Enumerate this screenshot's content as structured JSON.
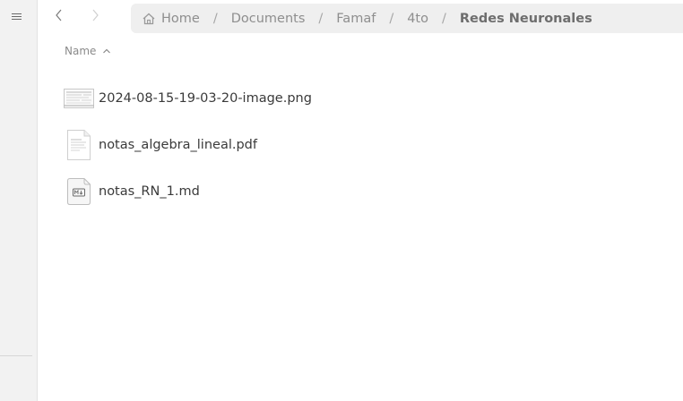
{
  "sidebar": {
    "menu_icon": "hamburger-menu-icon"
  },
  "navigation": {
    "back_icon": "chevron-left-icon",
    "forward_icon": "chevron-right-icon"
  },
  "pathbar": {
    "home_icon": "home-icon",
    "crumbs": [
      "Home",
      "Documents",
      "Famaf",
      "4to",
      "Redes Neuronales"
    ],
    "separator": "/"
  },
  "list": {
    "column_name": "Name",
    "sort_icon": "chevron-up-icon",
    "files": [
      {
        "name": "2024-08-15-19-03-20-image.png",
        "icon": "image-thumbnail-icon"
      },
      {
        "name": "notas_algebra_lineal.pdf",
        "icon": "pdf-document-icon"
      },
      {
        "name": "notas_RN_1.md",
        "icon": "markdown-file-icon"
      }
    ]
  },
  "colors": {
    "sidebar_bg": "#f2f2f2",
    "pathbar_bg": "#efefef",
    "text": "#3a3a3a",
    "muted": "#8e8e8e"
  }
}
